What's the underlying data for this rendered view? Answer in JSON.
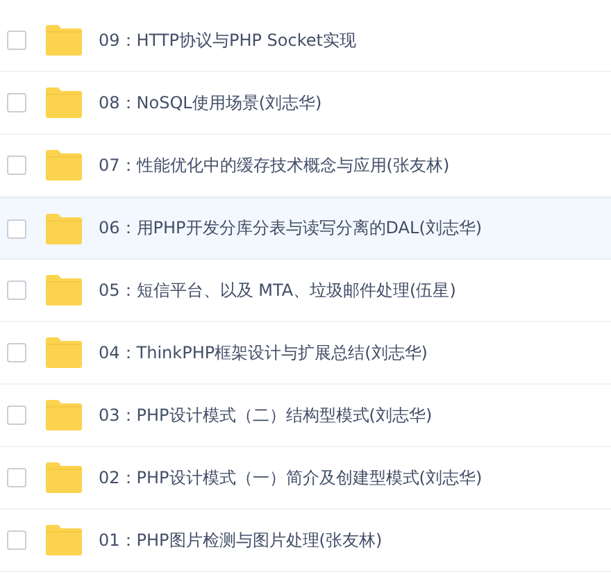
{
  "files": [
    {
      "name": "09：HTTP协议与PHP Socket实现",
      "checked": false,
      "selected": false
    },
    {
      "name": "08：NoSQL使用场景(刘志华)",
      "checked": false,
      "selected": false
    },
    {
      "name": "07：性能优化中的缓存技术概念与应用(张友林)",
      "checked": false,
      "selected": false
    },
    {
      "name": "06：用PHP开发分库分表与读写分离的DAL(刘志华)",
      "checked": false,
      "selected": true
    },
    {
      "name": "05：短信平台、以及 MTA、垃圾邮件处理(伍星)",
      "checked": false,
      "selected": false
    },
    {
      "name": "04：ThinkPHP框架设计与扩展总结(刘志华)",
      "checked": false,
      "selected": false
    },
    {
      "name": "03：PHP设计模式（二）结构型模式(刘志华)",
      "checked": false,
      "selected": false
    },
    {
      "name": "02：PHP设计模式（一）简介及创建型模式(刘志华)",
      "checked": false,
      "selected": false
    },
    {
      "name": "01：PHP图片检测与图片处理(张友林)",
      "checked": false,
      "selected": false
    }
  ]
}
